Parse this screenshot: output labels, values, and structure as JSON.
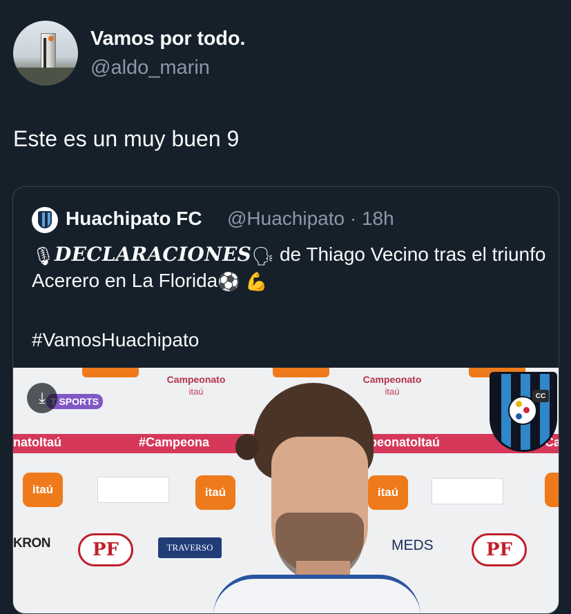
{
  "author": {
    "display_name": "Vamos por todo.",
    "handle": "@aldo_marin"
  },
  "tweet": {
    "text": "Este es un muy buen 9"
  },
  "quoted_tweet": {
    "display_name": "Huachipato FC",
    "handle_time": "@Huachipato · 18h",
    "text_part1": "DECLARACIONES",
    "text_part2": " de Thiago Vecino tras el triunfo Acerero en La Florida",
    "emoji_mic": "🎙",
    "emoji_speaking": "🗣",
    "emoji_ball": "⚽",
    "emoji_muscle": "💪",
    "hashtag": "#VamosHuachipato"
  },
  "media": {
    "download_icon": "⤓",
    "sports_label": "T SPORTS",
    "band_left": "natoItaú",
    "band_mid": "#Campeona",
    "band_right": "mpeonatoItaú",
    "band_far": "#Ca",
    "campeonato_1": "Campeonato",
    "itau_1": "itaú",
    "campeonato_2": "Campeonato",
    "itau_2": "itaú",
    "itau_tile_1": "itaú",
    "itau_tile_2": "itaú",
    "itau_tile_3": "itaú",
    "itau_tile_4": "it",
    "kron": "KRON",
    "pf_1": "PF",
    "pf_2": "PF",
    "traverso": "TRAVERSO",
    "meds": "MEDS",
    "cc_badge": "CC"
  }
}
